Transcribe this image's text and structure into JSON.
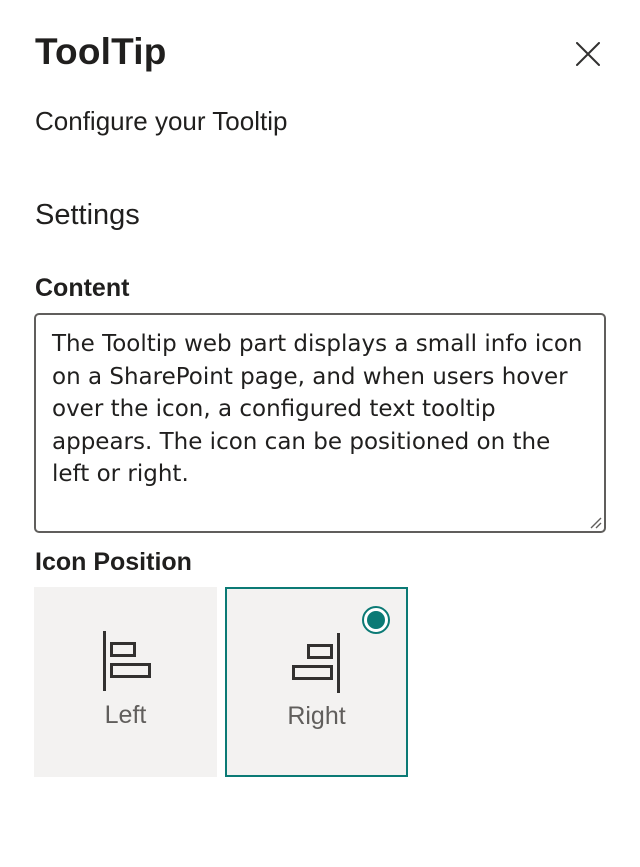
{
  "panel": {
    "title": "ToolTip",
    "description": "Configure your Tooltip",
    "close_icon": "close-icon"
  },
  "settings": {
    "group_name": "Settings",
    "content": {
      "label": "Content",
      "value": "The Tooltip web part displays a small info icon on a SharePoint page, and when users hover over the icon, a configured text tooltip appears. The icon can be positioned on the left or right."
    },
    "icon_position": {
      "label": "Icon Position",
      "options": [
        {
          "label": "Left",
          "icon": "align-left-icon",
          "selected": false
        },
        {
          "label": "Right",
          "icon": "align-right-icon",
          "selected": true
        }
      ],
      "selected_value": "Right"
    }
  },
  "colors": {
    "accent": "#0b7a75",
    "text": "#201f1e",
    "secondary_text": "#605e5c",
    "choice_background": "#f3f2f1",
    "border": "#605e5c"
  }
}
